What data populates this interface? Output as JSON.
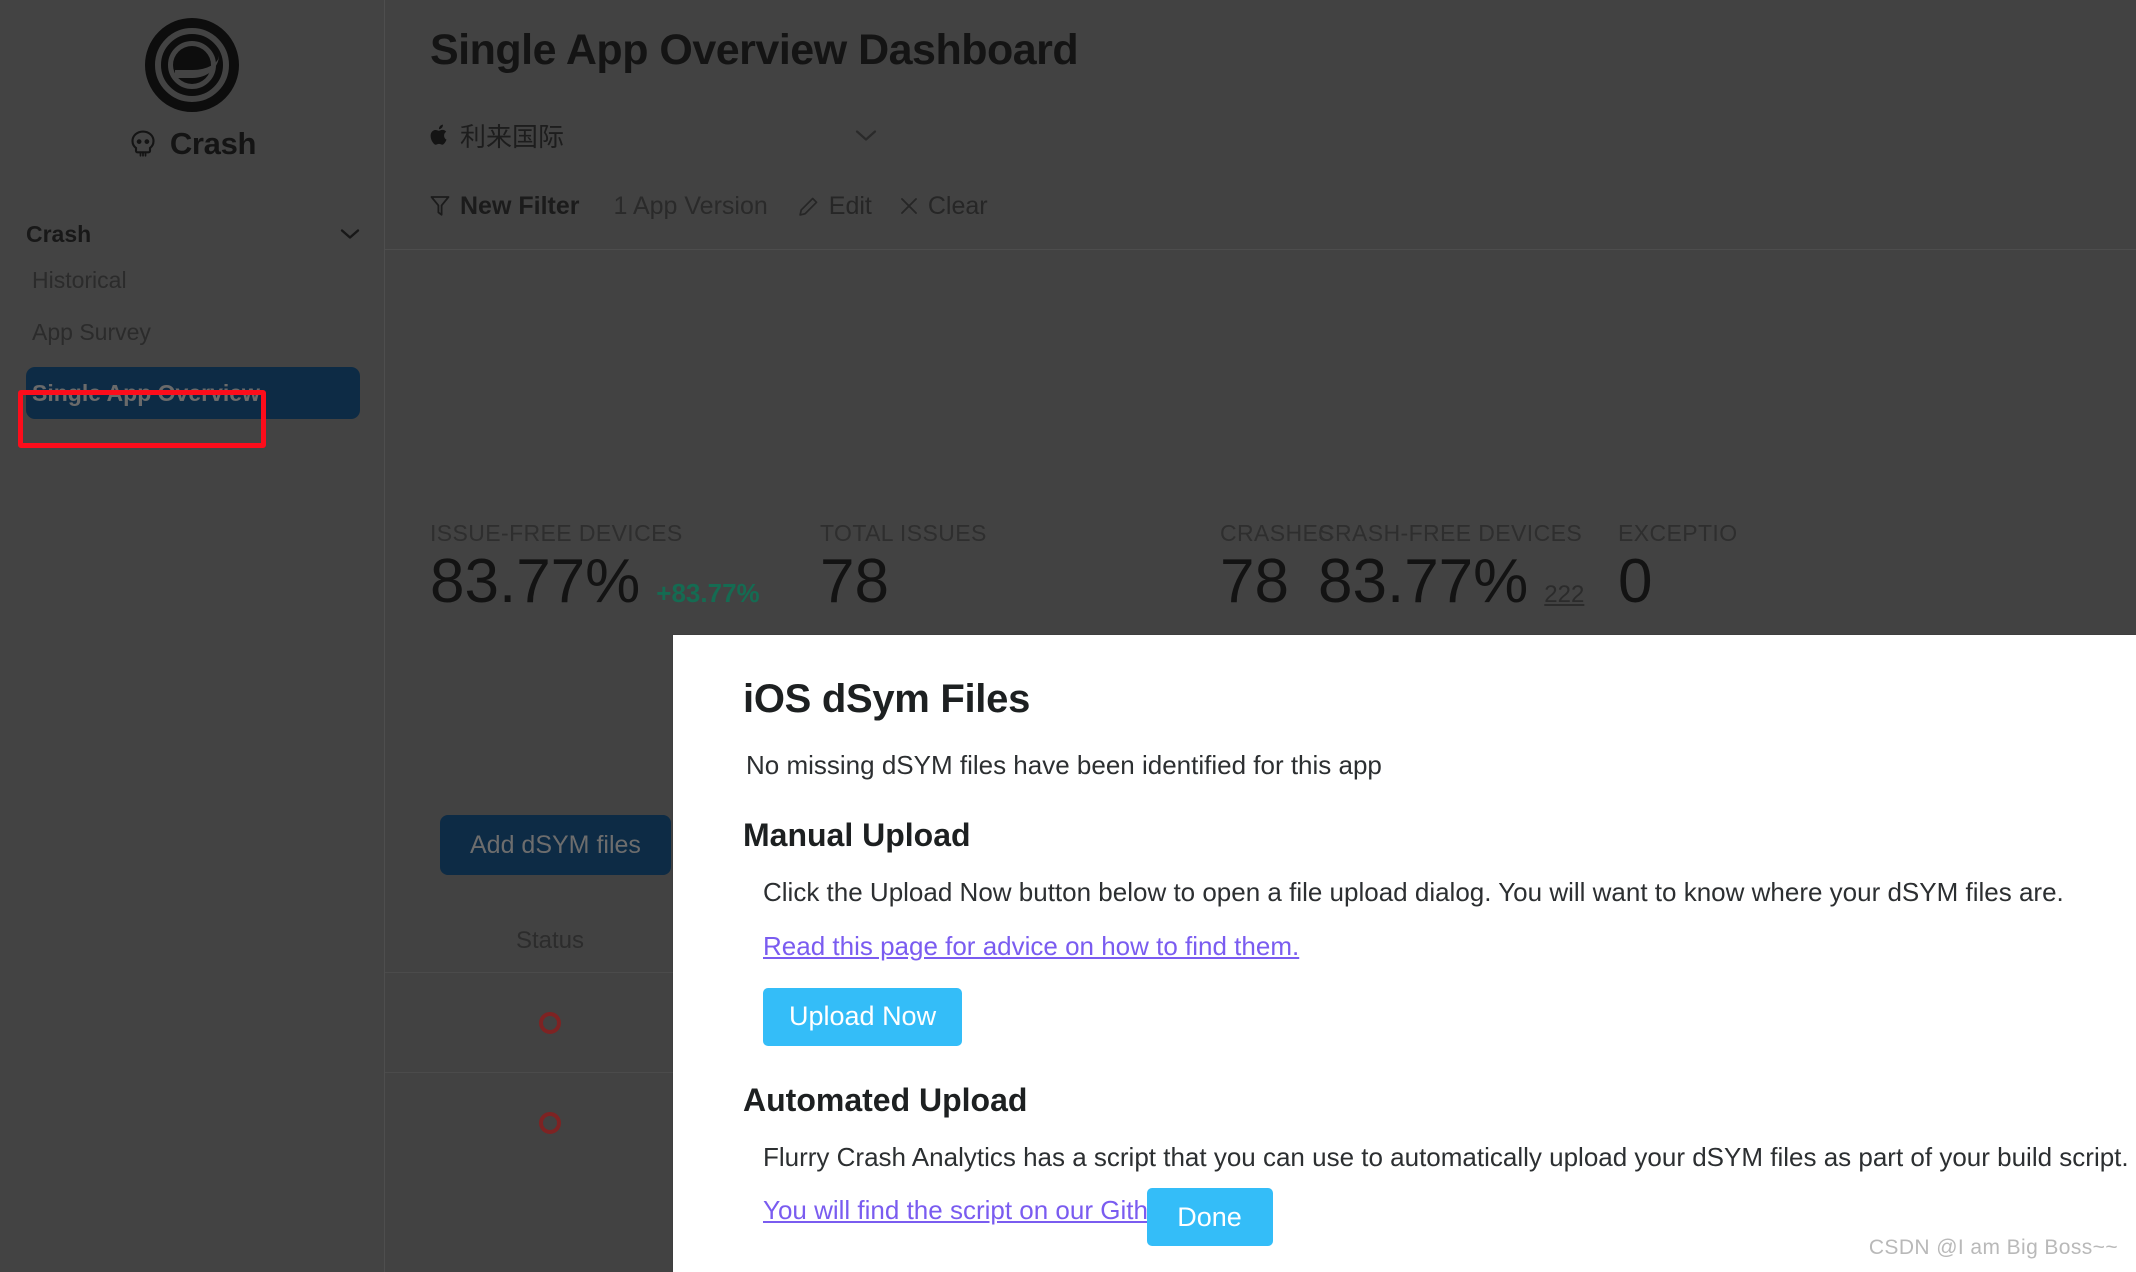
{
  "sidebar": {
    "logo_icon": "flurry-logo-icon",
    "brand_icon": "skull-icon",
    "brand_name": "Crash",
    "group_label": "Crash",
    "group_chevron_icon": "chevron-down-icon",
    "items": [
      {
        "label": "Historical",
        "active": false
      },
      {
        "label": "App Survey",
        "active": false
      },
      {
        "label": "Single App Overview",
        "active": true
      }
    ],
    "active_highlight_color": "#0d2b45",
    "annotation_color": "#fc0d1b"
  },
  "header": {
    "title": "Single App Overview Dashboard",
    "app_selector": {
      "platform_icon": "apple-icon",
      "app_name": "利来国际",
      "chevron_icon": "chevron-down-icon"
    }
  },
  "filter_bar": {
    "funnel_icon": "filter-funnel-icon",
    "new_filter_label": "New Filter",
    "app_version_label": "1 App Version",
    "edit_icon": "pencil-icon",
    "edit_label": "Edit",
    "clear_icon": "close-x-icon",
    "clear_label": "Clear"
  },
  "metrics": [
    {
      "label": "ISSUE-FREE DEVICES",
      "value": "83.77%",
      "delta": "+83.77%",
      "delta_color": "#156b52",
      "sub": ""
    },
    {
      "label": "TOTAL ISSUES",
      "value": "78",
      "delta": "",
      "sub": ""
    },
    {
      "label": "CRASHES",
      "value": "78",
      "delta": "",
      "sub": ""
    },
    {
      "label": "CRASH-FREE DEVICES",
      "value": "83.77%",
      "delta": "",
      "sub": "222"
    },
    {
      "label": "EXCEPTIO",
      "value": "0",
      "delta": "",
      "sub": ""
    }
  ],
  "dsym_panel": {
    "add_button_label": "Add dSYM files",
    "table": {
      "columns": [
        "Status"
      ],
      "rows": [
        {
          "status_icon": "status-circle-icon"
        },
        {
          "status_icon": "status-circle-icon"
        }
      ]
    }
  },
  "modal": {
    "title": "iOS dSym Files",
    "subtitle": "No missing dSYM files have been identified for this app",
    "manual": {
      "heading": "Manual Upload",
      "body": "Click the Upload Now button below to open a file upload dialog. You will want to know where your dSYM files are.",
      "link": "Read this page for advice on how to find them.",
      "button_label": "Upload Now"
    },
    "automated": {
      "heading": "Automated Upload",
      "body": "Flurry Crash Analytics has a script that you can use to automatically upload your dSYM files as part of your build script.",
      "link": "You will find the script on our Github page."
    },
    "done_label": "Done",
    "accent_color": "#34bdf8",
    "link_color": "#7a5cf0"
  },
  "watermark": "CSDN @I am Big Boss~~"
}
